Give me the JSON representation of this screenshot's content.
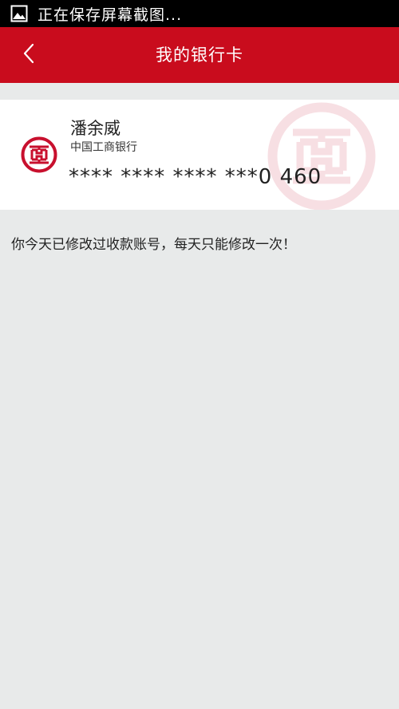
{
  "status_bar": {
    "text": "正在保存屏幕截图..."
  },
  "header": {
    "title": "我的银行卡"
  },
  "card": {
    "holder_name": "潘余威",
    "bank_name": "中国工商银行",
    "card_number": "**** **** **** ***0 460"
  },
  "notice": "你今天已修改过收款账号，每天只能修改一次！",
  "colors": {
    "header_bg": "#c90c1d",
    "bank_red": "#c8102e",
    "page_bg": "#e8eaea"
  },
  "icons": {
    "status": "image-icon",
    "back": "chevron-left-icon",
    "bank": "icbc-logo-icon"
  }
}
